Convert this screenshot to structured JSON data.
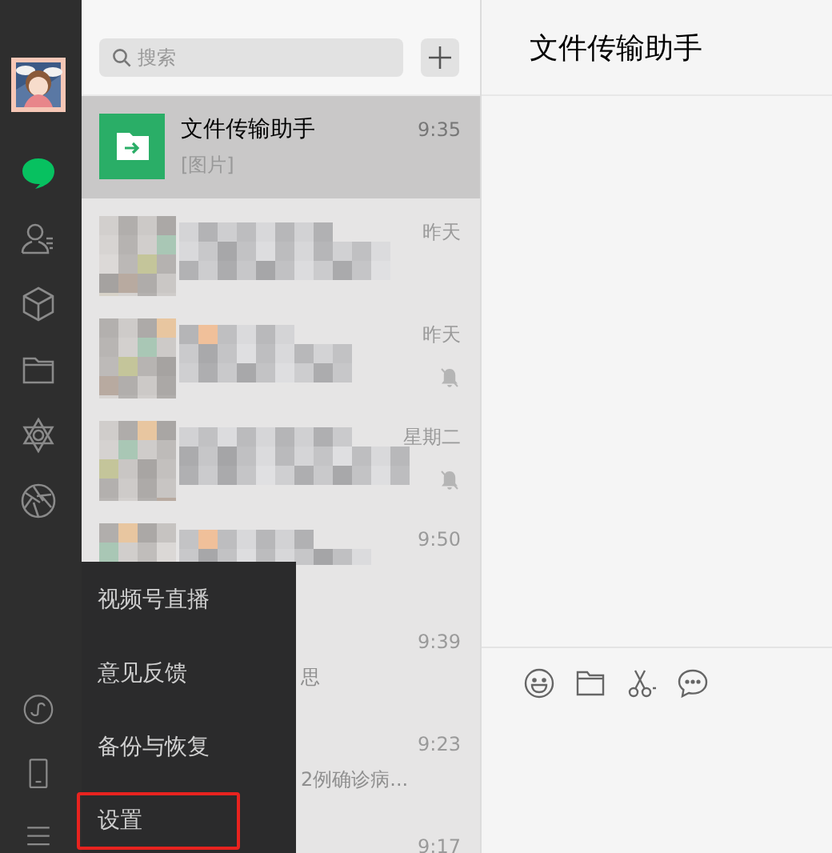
{
  "sidebar": {
    "items": [
      {
        "kind": "chat",
        "selected": true
      },
      {
        "kind": "contacts",
        "selected": false
      },
      {
        "kind": "cube",
        "selected": false
      },
      {
        "kind": "folder",
        "selected": false
      },
      {
        "kind": "moments",
        "selected": false
      },
      {
        "kind": "aperture",
        "selected": false
      }
    ],
    "bottom_items": [
      {
        "kind": "miniprogram"
      },
      {
        "kind": "phone"
      },
      {
        "kind": "menu"
      }
    ]
  },
  "search": {
    "placeholder": "搜索"
  },
  "chats": [
    {
      "kind": "file",
      "name": "文件传输助手",
      "preview": "[图片]",
      "time": "9:35",
      "selected": true,
      "muted": false
    },
    {
      "kind": "blurred",
      "time": "昨天",
      "selected": false,
      "muted": false
    },
    {
      "kind": "blurred",
      "time": "昨天",
      "selected": false,
      "muted": true
    },
    {
      "kind": "blurred",
      "time": "星期二",
      "selected": false,
      "muted": true
    },
    {
      "kind": "partial",
      "time": "9:50",
      "selected": false,
      "muted": false
    },
    {
      "kind": "covered",
      "preview": "思",
      "time": "9:39",
      "selected": false,
      "muted": false
    },
    {
      "kind": "covered",
      "preview": "2例确诊病...",
      "time": "9:23",
      "selected": false,
      "muted": false
    },
    {
      "kind": "covered",
      "time": "9:17",
      "selected": false,
      "muted": false
    }
  ],
  "conversation": {
    "title": "文件传输助手",
    "tools": [
      {
        "kind": "emoji"
      },
      {
        "kind": "folder"
      },
      {
        "kind": "scissors"
      },
      {
        "kind": "chat"
      }
    ]
  },
  "menu": {
    "items": [
      {
        "label": "视频号直播",
        "highlighted": false
      },
      {
        "label": "意见反馈",
        "highlighted": false
      },
      {
        "label": "备份与恢复",
        "highlighted": false
      },
      {
        "label": "设置",
        "highlighted": true
      }
    ]
  }
}
